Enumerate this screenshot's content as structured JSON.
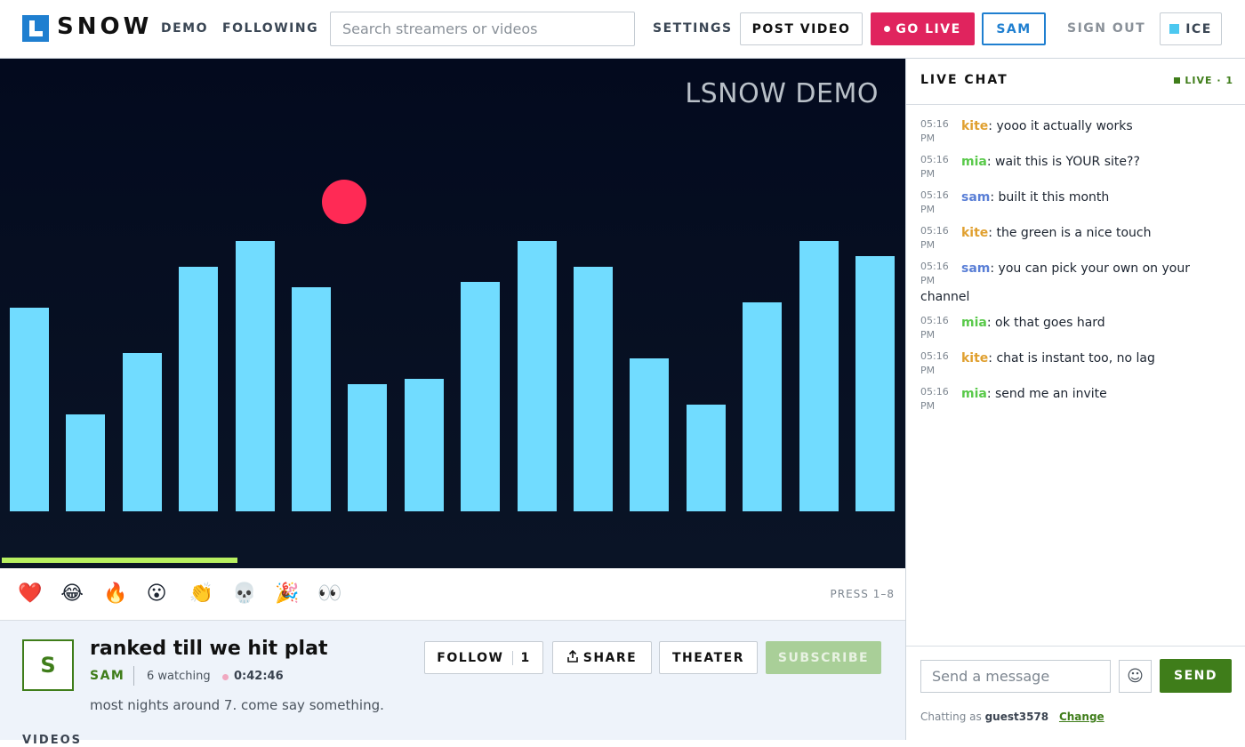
{
  "header": {
    "logo_text": "SNOW",
    "nav": [
      "DEMO",
      "FOLLOWING"
    ],
    "search_placeholder": "Search streamers or videos",
    "settings": "SETTINGS",
    "post_video": "POST VIDEO",
    "go_live": "GO LIVE",
    "user": "SAM",
    "sign_out": "SIGN OUT",
    "theme": "ICE"
  },
  "video": {
    "watermark": "LSNOW DEMO",
    "bar_color": "#71dcff",
    "ball_color": "#ff2a55",
    "bar_levels": [
      0.4,
      0.19,
      0.31,
      0.48,
      0.53,
      0.44,
      0.25,
      0.26,
      0.45,
      0.53,
      0.48,
      0.3,
      0.21,
      0.41,
      0.53,
      0.5
    ],
    "progress": 0.26
  },
  "reactions": {
    "emojis": [
      "❤️",
      "😂",
      "🔥",
      "😮",
      "👏",
      "💀",
      "🎉",
      "👀"
    ],
    "emoji_names": [
      "heart-icon",
      "laugh-icon",
      "fire-icon",
      "wow-icon",
      "clap-icon",
      "skull-icon",
      "party-icon",
      "eyes-icon"
    ],
    "hint": "PRESS 1–8"
  },
  "stream": {
    "avatar_letter": "S",
    "title": "ranked till we hit plat",
    "streamer": "SAM",
    "watching": "6 watching",
    "duration": "0:42:46",
    "description": "most nights around 7. come say something.",
    "videos_label": "VIDEOS",
    "follow": "FOLLOW",
    "follow_count": "1",
    "share": "SHARE",
    "theater": "THEATER",
    "subscribe": "SUBSCRIBE"
  },
  "chat": {
    "title": "LIVE CHAT",
    "live_label": "LIVE",
    "live_count": "· 1",
    "messages": [
      {
        "time": "05:16 PM",
        "user": "kite",
        "color": "#e0a030",
        "text": "yooo it actually works"
      },
      {
        "time": "05:16 PM",
        "user": "mia",
        "color": "#59c94a",
        "text": "wait this is YOUR site??"
      },
      {
        "time": "05:16 PM",
        "user": "sam",
        "color": "#5a7fd6",
        "text": "built it this month"
      },
      {
        "time": "05:16 PM",
        "user": "kite",
        "color": "#e0a030",
        "text": "the green is a nice touch"
      },
      {
        "time": "05:16 PM",
        "user": "sam",
        "color": "#5a7fd6",
        "text": "you can pick your own on your channel"
      },
      {
        "time": "05:16 PM",
        "user": "mia",
        "color": "#59c94a",
        "text": "ok that goes hard"
      },
      {
        "time": "05:16 PM",
        "user": "kite",
        "color": "#e0a030",
        "text": "chat is instant too, no lag"
      },
      {
        "time": "05:16 PM",
        "user": "mia",
        "color": "#59c94a",
        "text": "send me an invite"
      }
    ],
    "input_placeholder": "Send a message",
    "send": "SEND",
    "chatting_as": "Chatting as",
    "guest": "guest3578",
    "change": "Change"
  }
}
